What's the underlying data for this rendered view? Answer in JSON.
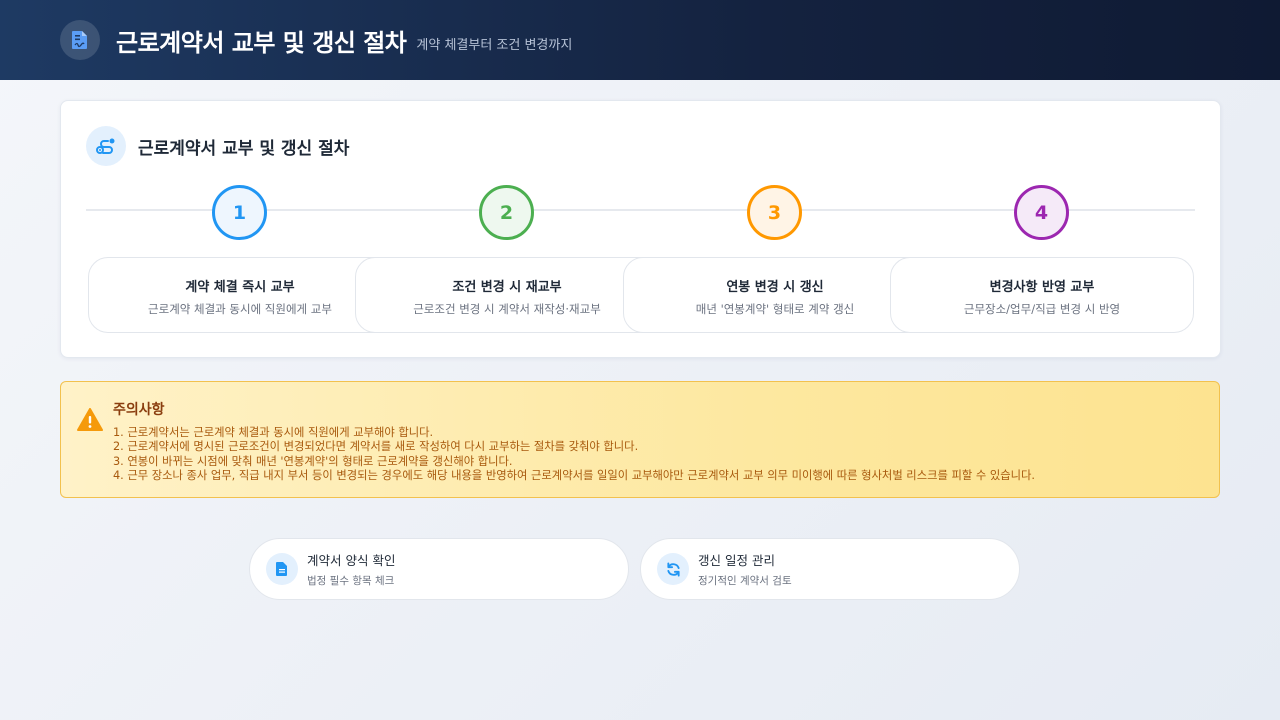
{
  "header": {
    "title": "근로계약서 교부 및 갱신 절차",
    "subtitle": "계약 체결부터 조건 변경까지",
    "icon": "contract-document-icon"
  },
  "procedure": {
    "title": "근로계약서 교부 및 갱신 절차",
    "icon": "route-icon",
    "steps": [
      {
        "number": "1",
        "title": "계약 체결 즉시 교부",
        "description": "근로계약 체결과 동시에 직원에게 교부",
        "color": "#2196f3",
        "bg": "#eef6fe"
      },
      {
        "number": "2",
        "title": "조건 변경 시 재교부",
        "description": "근로조건 변경 시 계약서 재작성·재교부",
        "color": "#4caf50",
        "bg": "#eef8ef"
      },
      {
        "number": "3",
        "title": "연봉 변경 시 갱신",
        "description": "매년 '연봉계약' 형태로 계약 갱신",
        "color": "#ff9800",
        "bg": "#fff4e6"
      },
      {
        "number": "4",
        "title": "변경사항 반영 교부",
        "description": "근무장소/업무/직급 변경 시 반영",
        "color": "#9c27b0",
        "bg": "#f5eaf8"
      }
    ]
  },
  "notice": {
    "title": "주의사항",
    "icon": "warning-icon",
    "items": [
      "1. 근로계약서는 근로계약 체결과 동시에 직원에게 교부해야 합니다.",
      "2. 근로계약서에 명시된 근로조건이 변경되었다면 계약서를 새로 작성하여 다시 교부하는 절차를 갖춰야 합니다.",
      "3. 연봉이 바뀌는 시점에 맞춰 매년 '연봉계약'의 형태로 근로계약을 갱신해야 합니다.",
      "4. 근무 장소나 종사 업무, 직급 내지 부서 등이 변경되는 경우에도 해당 내용을 반영하여 근로계약서를 일일이 교부해야만 근로계약서 교부 의무 미이행에 따른 형사처벌 리스크를 피할 수 있습니다."
    ]
  },
  "actions": [
    {
      "title": "계약서 양식 확인",
      "subtitle": "법정 필수 항목 체크",
      "icon": "file-icon"
    },
    {
      "title": "갱신 일정 관리",
      "subtitle": "정기적인 계약서 검토",
      "icon": "refresh-icon"
    }
  ]
}
